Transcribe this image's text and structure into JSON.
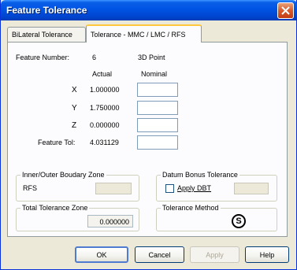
{
  "window": {
    "title": "Feature Tolerance"
  },
  "tabs": [
    {
      "label": "BiLateral Tolerance",
      "active": false
    },
    {
      "label": "Tolerance - MMC / LMC / RFS",
      "active": true
    }
  ],
  "feature": {
    "number_label": "Feature Number:",
    "number_value": "6",
    "type": "3D Point"
  },
  "columns": {
    "actual": "Actual",
    "nominal": "Nominal"
  },
  "rows": [
    {
      "label": "X",
      "actual": "1.000000",
      "nominal": ""
    },
    {
      "label": "Y",
      "actual": "1.750000",
      "nominal": ""
    },
    {
      "label": "Z",
      "actual": "0.000000",
      "nominal": ""
    },
    {
      "label": "Feature Tol:",
      "actual": "4.031129",
      "nominal": ""
    }
  ],
  "groups": {
    "boundary": {
      "title": "Inner/Outer Boudary Zone",
      "value": "RFS"
    },
    "datum_bonus": {
      "title": "Datum Bonus Tolerance",
      "checkbox_label": "Apply DBT",
      "checked": false
    },
    "total_zone": {
      "title": "Total Tolerance Zone",
      "value": "0.000000"
    },
    "method": {
      "title": "Tolerance Method",
      "symbol": "S"
    }
  },
  "buttons": {
    "ok": "OK",
    "cancel": "Cancel",
    "apply": "Apply",
    "help": "Help"
  },
  "colors": {
    "titlebar": "#0054e3",
    "panel": "#fcfcfe",
    "dialog": "#ece9d8",
    "close": "#d85a2c"
  }
}
